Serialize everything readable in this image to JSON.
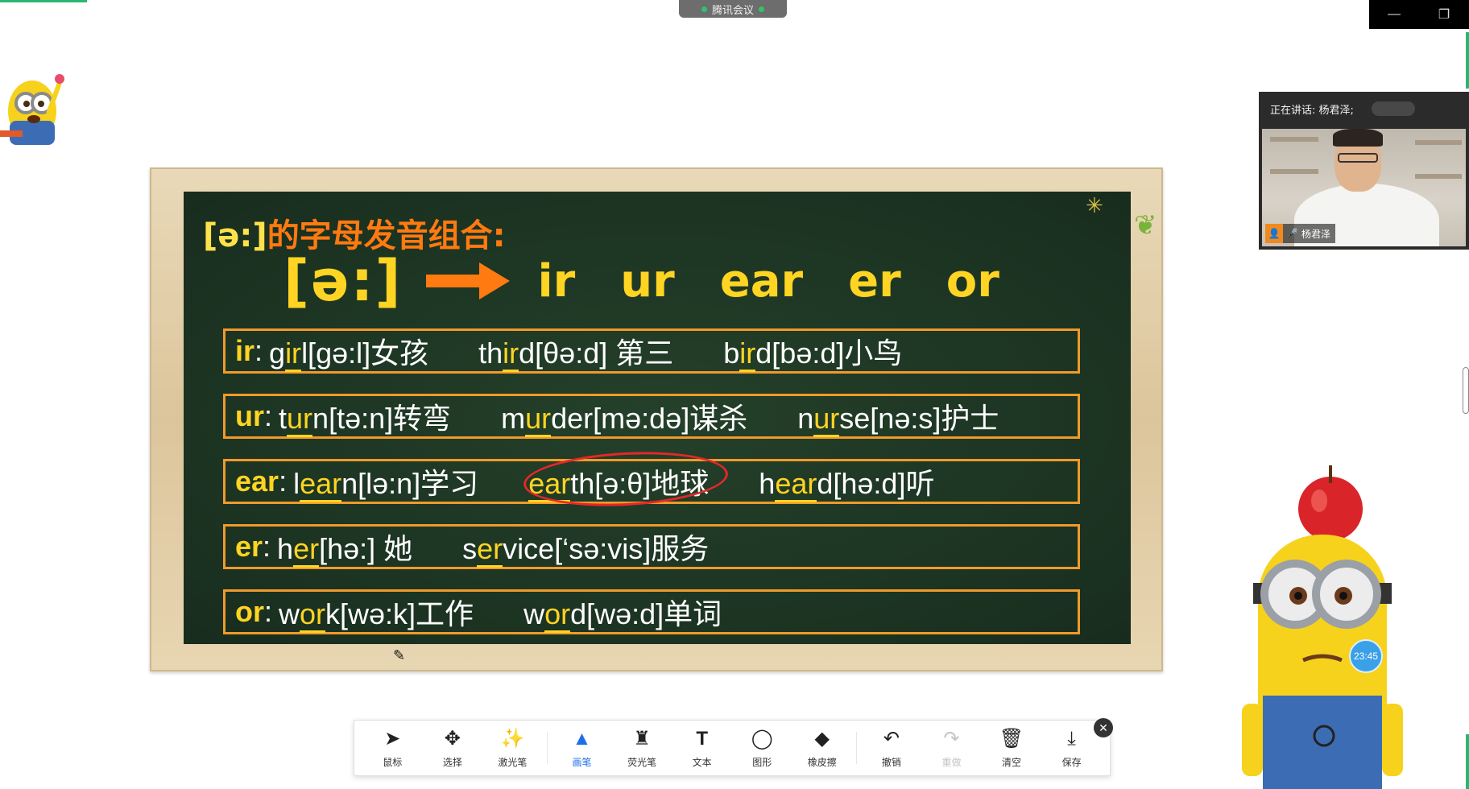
{
  "meeting": {
    "title": "腾讯会议"
  },
  "window": {
    "minimize": "—",
    "restore": "❐"
  },
  "speaker": {
    "status": "正在讲话: 杨君泽;",
    "name": "杨君泽"
  },
  "board": {
    "title_ipa": "[ə:]",
    "title_text": "的字母发音组合:",
    "phoneme": "[ə:]",
    "combos": [
      "ir",
      "ur",
      "ear",
      "er",
      "or"
    ],
    "rows": [
      {
        "key": "ir",
        "words": [
          {
            "pre": "g",
            "hl": "ir",
            "post": "l[gə:l]女孩"
          },
          {
            "pre": "th",
            "hl": "ir",
            "post": "d[θə:d] 第三"
          },
          {
            "pre": "b",
            "hl": "ir",
            "post": "d[bə:d]小鸟"
          }
        ]
      },
      {
        "key": "ur",
        "words": [
          {
            "pre": "t",
            "hl": "ur",
            "post": "n[tə:n]转弯"
          },
          {
            "pre": "m",
            "hl": "ur",
            "post": "der[mə:də]谋杀"
          },
          {
            "pre": "n",
            "hl": "ur",
            "post": "se[nə:s]护士"
          }
        ]
      },
      {
        "key": "ear",
        "words": [
          {
            "pre": "l",
            "hl": "ear",
            "post": "n[lə:n]学习"
          },
          {
            "pre": "",
            "hl": "ear",
            "post": "th[ə:θ]地球",
            "circled": true
          },
          {
            "pre": "h",
            "hl": "ear",
            "post": "d[hə:d]听"
          }
        ]
      },
      {
        "key": "er",
        "words": [
          {
            "pre": "h",
            "hl": "er",
            "post": "[hə:] 她"
          },
          {
            "pre": "s",
            "hl": "er",
            "post": "vice[‘sə:vis]服务"
          }
        ]
      },
      {
        "key": "or",
        "words": [
          {
            "pre": "w",
            "hl": "or",
            "post": "k[wə:k]工作"
          },
          {
            "pre": "w",
            "hl": "or",
            "post": "d[wə:d]单词"
          }
        ]
      }
    ]
  },
  "toolbar": {
    "mouse": "鼠标",
    "select": "选择",
    "laser": "激光笔",
    "pen": "画笔",
    "highlighter": "荧光笔",
    "text": "文本",
    "shape": "图形",
    "eraser": "橡皮擦",
    "undo": "撤销",
    "redo": "重做",
    "clear": "清空",
    "save": "保存"
  },
  "timer": "23:45",
  "colors": {
    "board_bg": "#1c3322",
    "accent_yellow": "#ffd423",
    "accent_orange": "#ff7a10",
    "row_border": "#f09a2a",
    "circle_red": "#e42828",
    "active_tool": "#1f6fe8"
  }
}
